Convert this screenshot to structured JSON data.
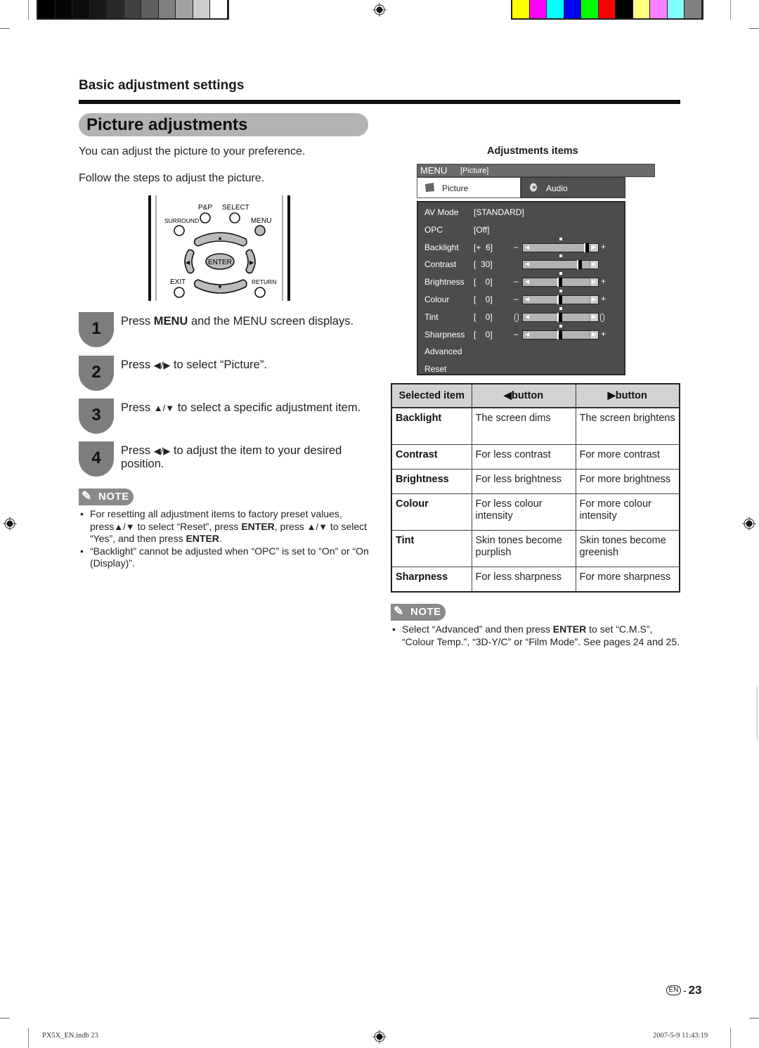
{
  "print_marks": {
    "gray_swatches": [
      "#000000",
      "#050505",
      "#0d0d0d",
      "#181818",
      "#282828",
      "#414141",
      "#5f5f5f",
      "#7f7f7f",
      "#a0a0a0",
      "#cdcdcd",
      "#ffffff"
    ],
    "color_swatches": [
      "#ffff00",
      "#ff00ff",
      "#00ffff",
      "#0000ff",
      "#00ff00",
      "#ff0000",
      "#000000",
      "#ffff80",
      "#ff80ff",
      "#80ffff",
      "#808080"
    ]
  },
  "header": {
    "section_title": "Basic adjustment settings",
    "page_title": "Picture adjustments"
  },
  "intro": {
    "line1": "You can adjust the picture to your preference.",
    "line2": "Follow the steps to adjust the picture."
  },
  "remote": {
    "labels": {
      "pp": "P&P",
      "select": "SELECT",
      "surround": "SURROUND",
      "menu": "MENU",
      "enter": "ENTER",
      "exit": "EXIT",
      "return": "RETURN"
    }
  },
  "steps": [
    {
      "num": "1",
      "pre": "Press ",
      "bold": "MENU",
      "post": " and the MENU screen displays."
    },
    {
      "num": "2",
      "pre": "Press ",
      "arrows": "◀/▶",
      "post": " to select “Picture”."
    },
    {
      "num": "3",
      "pre": "Press ",
      "arrows": "▲/▼",
      "post": " to select a specific adjustment item."
    },
    {
      "num": "4",
      "pre": "Press ",
      "arrows": "◀/▶",
      "post": " to adjust the item to your desired position."
    }
  ],
  "note_label": "NOTE",
  "notes_left": {
    "item1": {
      "t1": "For resetting all adjustment items to factory preset values, press",
      "a1": "▲/▼",
      "t2": " to select “Reset”, press ",
      "b1": "ENTER",
      "t3": ", press ",
      "a2": "▲/▼",
      "t4": " to select “Yes”, and then press ",
      "b2": "ENTER",
      "t5": "."
    },
    "item2": "“Backlight” cannot be adjusted when “OPC” is set to “On” or “On (Display)”."
  },
  "menu_screen": {
    "caption": "Adjustments items",
    "menu_label": "MENU",
    "menu_path": "[Picture]",
    "tabs": [
      {
        "label": "Picture",
        "icon": "picture-icon",
        "selected": true
      },
      {
        "label": "Audio",
        "icon": "audio-icon",
        "selected": false
      }
    ],
    "rows": [
      {
        "name": "AV Mode",
        "value": "[STANDARD]"
      },
      {
        "name": "OPC",
        "value": "[Off]"
      },
      {
        "name": "Backlight",
        "value": "[+  6]",
        "slider": 0.86,
        "ends": "pm"
      },
      {
        "name": "Contrast",
        "value": "[  30]",
        "slider": 0.76,
        "ends": "none"
      },
      {
        "name": "Brightness",
        "value": "[    0]",
        "slider": 0.5,
        "ends": "pm"
      },
      {
        "name": "Colour",
        "value": "[    0]",
        "slider": 0.5,
        "ends": "pm"
      },
      {
        "name": "Tint",
        "value": "[    0]",
        "slider": 0.5,
        "ends": "oval"
      },
      {
        "name": "Sharpness",
        "value": "[    0]",
        "slider": 0.5,
        "ends": "pm"
      },
      {
        "name": "Advanced"
      },
      {
        "name": "Reset"
      }
    ],
    "minus": "–",
    "plus": "+"
  },
  "table": {
    "headers": [
      "Selected item",
      "◀button",
      "▶button"
    ],
    "rows": [
      [
        "Backlight",
        "The screen dims",
        "The screen brightens"
      ],
      [
        "Contrast",
        "For less contrast",
        "For more contrast"
      ],
      [
        "Brightness",
        "For less brightness",
        "For more brightness"
      ],
      [
        "Colour",
        "For less colour intensity",
        "For more colour intensity"
      ],
      [
        "Tint",
        "Skin tones become purplish",
        "Skin tones become greenish"
      ],
      [
        "Sharpness",
        "For less sharpness",
        "For more sharpness"
      ]
    ]
  },
  "notes_right": {
    "t1": "Select “Advanced” and then press ",
    "b1": "ENTER",
    "t2": " to set “C.M.S”, “Colour Temp.”, “3D-Y/C” or “Film Mode”. See pages 24 and 25."
  },
  "page": {
    "lang": "EN",
    "dash": "-",
    "number": "23"
  },
  "footer": {
    "file": "PX5X_EN.indb   23",
    "timestamp": "2007-5-9   11:43:19"
  }
}
